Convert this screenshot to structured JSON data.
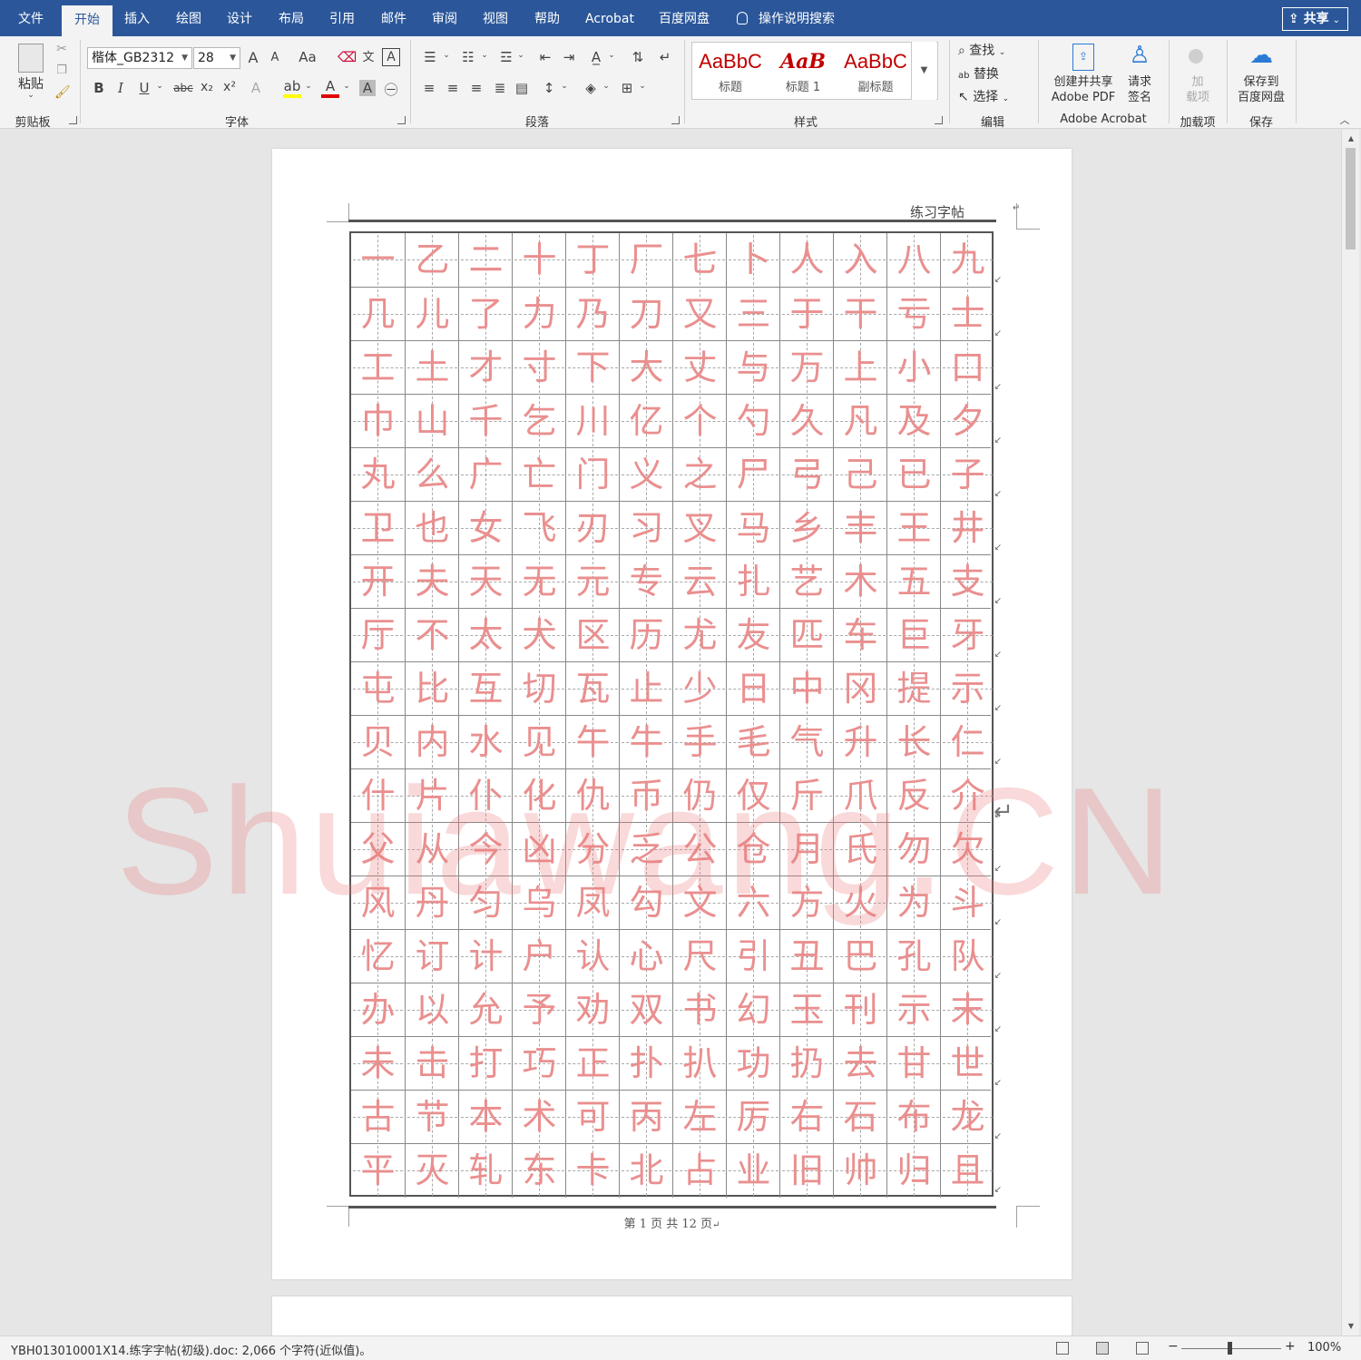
{
  "tabs": [
    "文件",
    "开始",
    "插入",
    "绘图",
    "设计",
    "布局",
    "引用",
    "邮件",
    "审阅",
    "视图",
    "帮助",
    "Acrobat",
    "百度网盘"
  ],
  "active_tab": "开始",
  "tell_me": "操作说明搜索",
  "share_label": "共享",
  "ribbon": {
    "clipboard": {
      "paste": "粘贴",
      "label": "剪贴板"
    },
    "font": {
      "family": "楷体_GB2312",
      "size": "28",
      "grow": "A",
      "shrink": "A",
      "change_case": "Aa",
      "bold": "B",
      "italic": "I",
      "underline": "U",
      "strike": "abc",
      "subscript": "x₂",
      "superscript": "x²",
      "font_color": "A",
      "char_shading": "A",
      "label": "字体"
    },
    "paragraph": {
      "label": "段落"
    },
    "styles": {
      "items": [
        {
          "sample": "AaBbC",
          "name": "标题"
        },
        {
          "sample": "AaB",
          "name": "标题 1"
        },
        {
          "sample": "AaBbC",
          "name": "副标题"
        }
      ],
      "label": "样式"
    },
    "editing": {
      "find": "查找",
      "replace": "替换",
      "select": "选择",
      "label": "编辑"
    },
    "acrobat": {
      "create_share": "创建并共享",
      "adobe_pdf": "Adobe PDF",
      "request": "请求",
      "sign": "签名",
      "label": "Adobe Acrobat"
    },
    "addins": {
      "line1": "加",
      "line2": "载项",
      "label": "加载项"
    },
    "save": {
      "line1": "保存到",
      "line2": "百度网盘",
      "label": "保存"
    }
  },
  "document": {
    "header": "练习字帖",
    "grid_rows": [
      "一乙二十丁厂七卜人入八九",
      "几儿了力乃刀又三于干亏士",
      "工土才寸下大丈与万上小口",
      "巾山千乞川亿个勺久凡及夕",
      "丸么广亡门义之尸弓己已子",
      "卫也女飞刃习叉马乡丰王井",
      "开夫天无元专云扎艺木五支",
      "厅不太犬区历尤友匹车巨牙",
      "屯比互切瓦止少日中冈提示",
      "贝内水见午牛手毛气升长仁",
      "什片仆化仇币仍仅斤爪反介",
      "父从今凶分乏公仓月氏勿欠",
      "风丹匀乌凤勾文六方火为斗",
      "忆订计户认心尺引丑巴孔队",
      "办以允予劝双书幻玉刊示末",
      "未击打巧正扑扒功扔去甘世",
      "古节本术可丙左厉右石布龙",
      "平灭轧东卡北占业旧帅归且"
    ],
    "footer": "第 1 页 共 12 页",
    "watermark": "Shuiawang.CN"
  },
  "status": {
    "doc_info": "YBH013010001X14.练字字帖(初级).doc: 2,066 个字符(近似值)。",
    "zoom": "100%"
  },
  "colors": {
    "title_bar": "#2b579a",
    "glyph": "#ea8f8f",
    "style_sample": "#c00000"
  }
}
